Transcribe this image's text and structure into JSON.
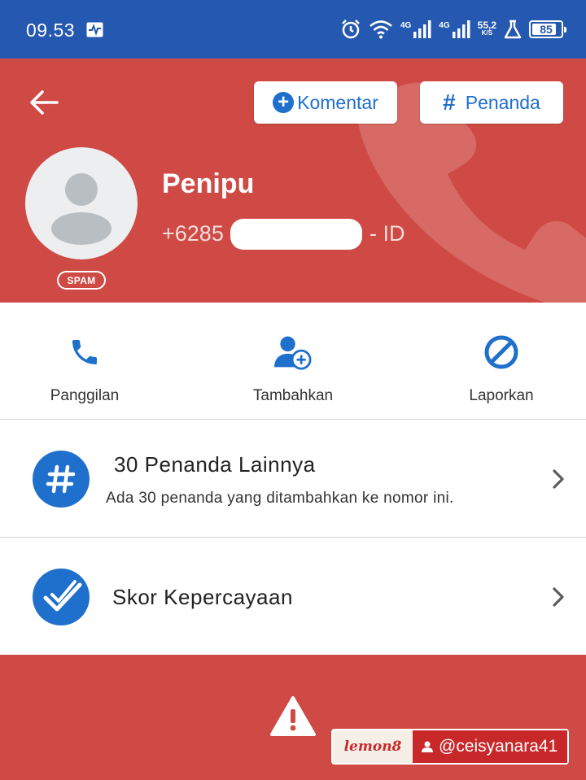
{
  "status_bar": {
    "time": "09.53",
    "network1": "4G",
    "network2": "4G",
    "speed_value": "55,2",
    "speed_unit": "K/S",
    "battery": "85",
    "battery_level": 0.85
  },
  "header": {
    "komentar_label": "Komentar",
    "penanda_label": "Penanda",
    "contact_name": "Penipu",
    "number_prefix": "+6285",
    "country_suffix": "- ID",
    "spam_badge": "SPAM"
  },
  "actions": {
    "call_label": "Panggilan",
    "add_label": "Tambahkan",
    "report_label": "Laporkan"
  },
  "tags_row": {
    "title": "30 Penanda Lainnya",
    "subtitle": "Ada 30 penanda yang ditambahkan ke nomor ini."
  },
  "trust_row": {
    "title": "Skor Kepercayaan"
  },
  "watermark": {
    "logo": "lemon8",
    "handle": "@ceisyanara41"
  },
  "colors": {
    "status_bar": "#2558b0",
    "header_red": "#cf4a44",
    "accent_blue": "#1f6fcc"
  },
  "icons": {
    "back": "arrow-left-icon",
    "call": "phone-icon",
    "add": "add-contact-icon",
    "report": "block-icon",
    "tags": "hash-icon",
    "trust": "checkmark-icon",
    "warning": "warning-icon"
  }
}
